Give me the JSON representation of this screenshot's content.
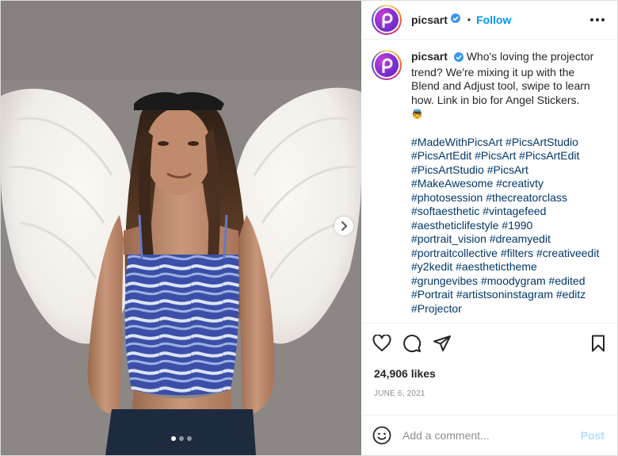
{
  "header": {
    "username": "picsart",
    "separator": "•",
    "follow_label": "Follow"
  },
  "caption": {
    "username": "picsart",
    "text": "Who's loving the projector trend? We're mixing it up with the Blend and Adjust tool, swipe to learn how. Link in bio for Angel Stickers.",
    "emoji": "👼",
    "hashtags": [
      "#MadeWithPicsArt",
      "#PicsArtStudio",
      "#PicsArtEdit",
      "#PicsArt",
      "#PicsArtEdit",
      "#PicsArtStudio",
      "#PicsArt",
      "#MakeAwesome",
      "#creativty",
      "#photosession",
      "#thecreatorclass",
      "#softaesthetic",
      "#vintagefeed",
      "#aestheticlifestyle",
      "#1990",
      "#portrait_vision",
      "#dreamyedit",
      "#portraitcollective",
      "#filters",
      "#creativeedit",
      "#y2kedit",
      "#aesthetictheme",
      "#grungevibes",
      "#moodygram",
      "#edited",
      "#Portrait",
      "#artistsoninstagram",
      "#editz",
      "#Projector"
    ]
  },
  "stats": {
    "likes": "24,906 likes",
    "date": "JUNE 6, 2021"
  },
  "comment_box": {
    "placeholder": "Add a comment...",
    "post_label": "Post"
  },
  "carousel": {
    "total_slides": 3,
    "active_slide": 1
  },
  "colors": {
    "follow_blue": "#0095f6",
    "hashtag_blue": "#00376b",
    "post_disabled": "#b2dffc",
    "verified_blue": "#3897f0"
  },
  "icons": {
    "avatar": "picsart-logo-icon",
    "verified": "verified-badge-icon",
    "more": "more-options-icon",
    "next": "chevron-right-icon",
    "like": "heart-icon",
    "comment": "comment-icon",
    "share": "send-icon",
    "save": "bookmark-icon",
    "emoji": "smiley-icon"
  }
}
